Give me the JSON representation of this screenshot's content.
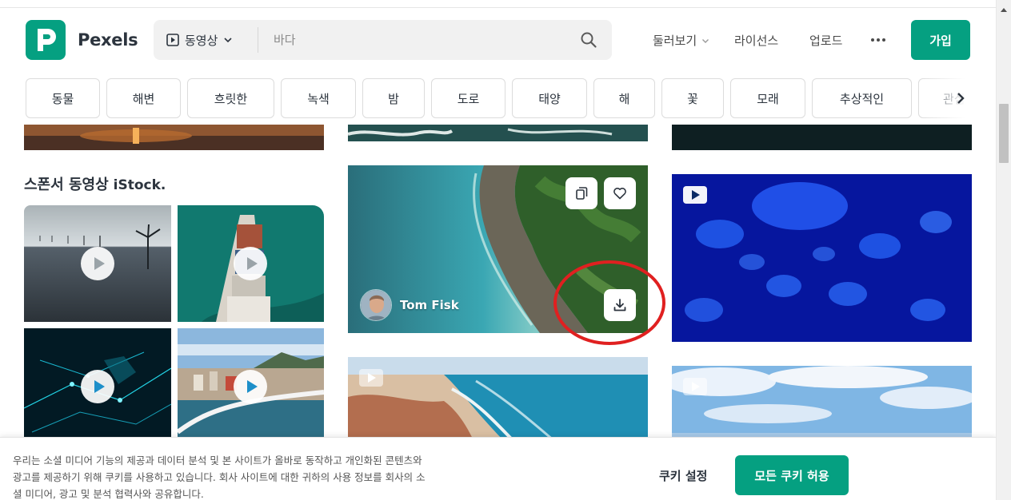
{
  "header": {
    "brand": "Pexels",
    "search_type": "동영상",
    "search_placeholder": "바다",
    "nav": {
      "explore": "둘러보기",
      "license": "라이선스",
      "upload": "업로드",
      "join": "가입"
    }
  },
  "chips": [
    "동물",
    "해변",
    "흐릿한",
    "녹색",
    "밤",
    "도로",
    "태양",
    "해",
    "꽃",
    "모래",
    "추상적인",
    "관심"
  ],
  "sponsor": {
    "title": "스폰서 동영상",
    "brand": "iStock."
  },
  "featured_video": {
    "author": "Tom Fisk"
  },
  "cookie": {
    "text_line1": "우리는 소셜 미디어 기능의 제공과 데이터 분석 및 본 사이트가 올바로 동작하고 개인화된 콘텐츠와",
    "text_line2": "광고를 제공하기 위해 쿠키를 사용하고 있습니다. 회사 사이트에 대한 귀하의 사용 정보를 회사의 소",
    "text_line3": "셜 미디어, 광고 및 분석 협력사와 공유합니다.",
    "settings": "쿠키 설정",
    "accept": "모든 쿠키 허용"
  },
  "colors": {
    "brand": "#05a081",
    "annotation": "#e02020"
  }
}
